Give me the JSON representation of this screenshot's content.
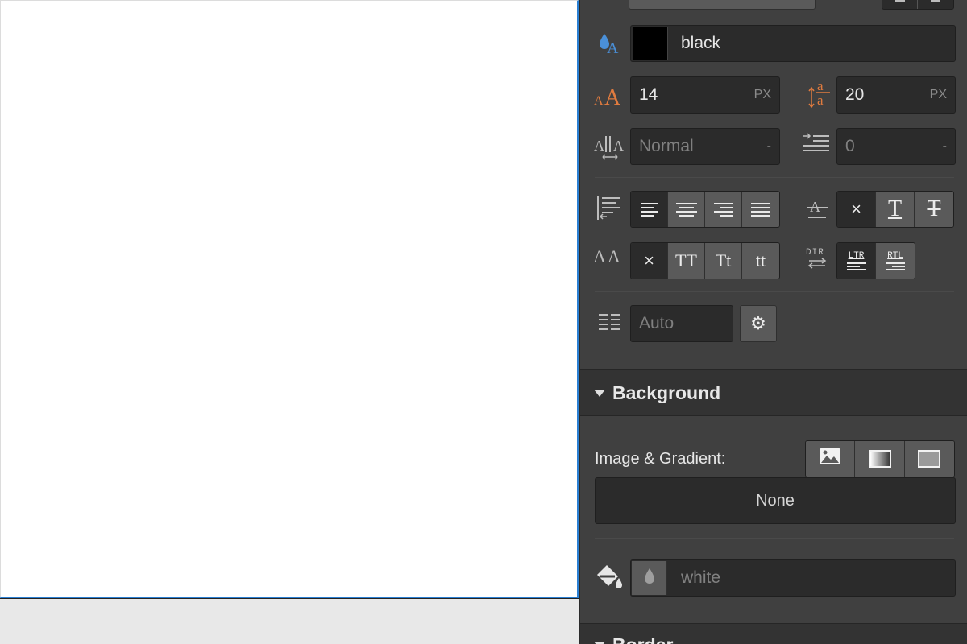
{
  "typography": {
    "color": {
      "value": "black",
      "swatch": "#000000"
    },
    "font_size": {
      "value": "14",
      "unit": "PX"
    },
    "line_height": {
      "value": "20",
      "unit": "PX"
    },
    "letter_spacing": {
      "value": "Normal",
      "unit": "-"
    },
    "text_indent": {
      "value": "0",
      "unit": "-"
    },
    "align_options": [
      "left",
      "center",
      "right",
      "justify"
    ],
    "align_active": "left",
    "decoration_options": [
      "×",
      "T",
      "T"
    ],
    "transform_options": [
      "×",
      "TT",
      "Tt",
      "tt"
    ],
    "direction_label": "DIR",
    "direction_options": [
      "LTR",
      "RTL"
    ],
    "columns": {
      "value": "Auto"
    },
    "letter_spacing_icon_text": "A A",
    "transform_icon_text": "AA"
  },
  "background": {
    "section_title": "Background",
    "image_gradient_label": "Image & Gradient:",
    "image_gradient_value": "None",
    "color": {
      "value": "white"
    }
  },
  "border": {
    "section_title": "Border"
  },
  "colors": {
    "canvas_outline": "#2a7fd3",
    "panel_bg": "#404040",
    "field_bg": "#2b2b2b",
    "button_bg": "#5a5a5a",
    "accent_icon": "#e07b3f",
    "drop_icon": "#4a90d9"
  }
}
